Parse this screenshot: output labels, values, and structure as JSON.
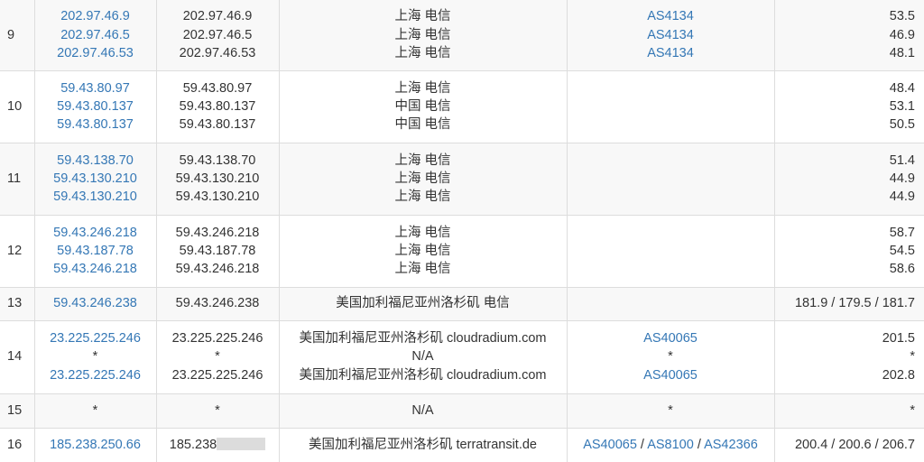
{
  "rows": [
    {
      "hop": "9",
      "ip_link": [
        "202.97.46.9",
        "202.97.46.5",
        "202.97.46.53"
      ],
      "ip": [
        "202.97.46.9",
        "202.97.46.5",
        "202.97.46.53"
      ],
      "location": [
        "上海 电信",
        "上海 电信",
        "上海 电信"
      ],
      "asn": [
        "AS4134",
        "AS4134",
        "AS4134"
      ],
      "latency": [
        "53.5",
        "46.9",
        "48.1"
      ]
    },
    {
      "hop": "10",
      "ip_link": [
        "59.43.80.97",
        "59.43.80.137",
        "59.43.80.137"
      ],
      "ip": [
        "59.43.80.97",
        "59.43.80.137",
        "59.43.80.137"
      ],
      "location": [
        "上海 电信",
        "中国 电信",
        "中国 电信"
      ],
      "asn": [],
      "latency": [
        "48.4",
        "53.1",
        "50.5"
      ]
    },
    {
      "hop": "11",
      "ip_link": [
        "59.43.138.70",
        "59.43.130.210",
        "59.43.130.210"
      ],
      "ip": [
        "59.43.138.70",
        "59.43.130.210",
        "59.43.130.210"
      ],
      "location": [
        "上海 电信",
        "上海 电信",
        "上海 电信"
      ],
      "asn": [],
      "latency": [
        "51.4",
        "44.9",
        "44.9"
      ]
    },
    {
      "hop": "12",
      "ip_link": [
        "59.43.246.218",
        "59.43.187.78",
        "59.43.246.218"
      ],
      "ip": [
        "59.43.246.218",
        "59.43.187.78",
        "59.43.246.218"
      ],
      "location": [
        "上海 电信",
        "上海 电信",
        "上海 电信"
      ],
      "asn": [],
      "latency": [
        "58.7",
        "54.5",
        "58.6"
      ]
    },
    {
      "hop": "13",
      "ip_link": [
        "59.43.246.238"
      ],
      "ip": [
        "59.43.246.238"
      ],
      "location": [
        "美国加利福尼亚州洛杉矶 电信"
      ],
      "asn": [],
      "latency": [
        "181.9 / 179.5 / 181.7"
      ]
    },
    {
      "hop": "14",
      "ip_link": [
        "23.225.225.246",
        "*",
        "23.225.225.246"
      ],
      "ip": [
        "23.225.225.246",
        "*",
        "23.225.225.246"
      ],
      "location": [
        "美国加利福尼亚州洛杉矶 cloudradium.com",
        "N/A",
        "美国加利福尼亚州洛杉矶 cloudradium.com"
      ],
      "asn": [
        "AS40065",
        "*",
        "AS40065"
      ],
      "latency": [
        "201.5",
        "*",
        "202.8"
      ]
    },
    {
      "hop": "15",
      "ip_link": [
        "*"
      ],
      "ip": [
        "*"
      ],
      "location": [
        "N/A"
      ],
      "asn": [
        "*"
      ],
      "latency": [
        "*"
      ]
    },
    {
      "hop": "16",
      "ip_link": [
        "185.238.250.66"
      ],
      "ip": [
        "185.238"
      ],
      "ip_masked": true,
      "location": [
        "美国加利福尼亚州洛杉矶 terratransit.de"
      ],
      "asn_inline": [
        "AS40065",
        "AS8100",
        "AS42366"
      ],
      "asn_sep": " / ",
      "latency": [
        "200.4 / 200.6 / 206.7"
      ]
    }
  ],
  "colors": {
    "link": "#3477b5",
    "text": "#333333",
    "border": "#dddddd",
    "stripe": "#f8f8f8"
  }
}
